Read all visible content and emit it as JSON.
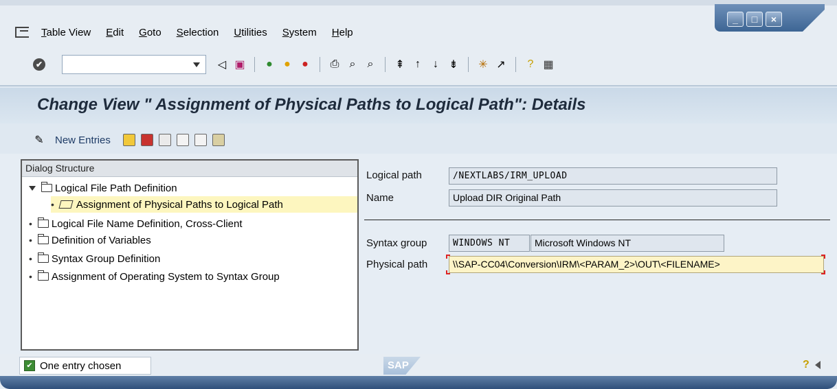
{
  "window": {
    "controls": [
      "_",
      "□",
      "×"
    ]
  },
  "menu": {
    "items": [
      "Table View",
      "Edit",
      "Goto",
      "Selection",
      "Utilities",
      "System",
      "Help"
    ]
  },
  "toolbar": {
    "command_field_value": ""
  },
  "screen": {
    "title": "Change View \" Assignment of Physical Paths to Logical Path\": Details"
  },
  "app_toolbar": {
    "new_entries_label": "New Entries"
  },
  "dialog_structure": {
    "header": "Dialog Structure",
    "items": [
      {
        "label": "Logical File Path Definition",
        "expanded": true
      },
      {
        "label": "Assignment of Physical Paths to Logical Path",
        "selected": true
      },
      {
        "label": "Logical File Name Definition, Cross-Client"
      },
      {
        "label": "Definition of Variables"
      },
      {
        "label": "Syntax Group Definition"
      },
      {
        "label": "Assignment of Operating System to Syntax Group"
      }
    ]
  },
  "details": {
    "logical_path_label": "Logical path",
    "logical_path_value": "/NEXTLABS/IRM_UPLOAD",
    "name_label": "Name",
    "name_value": "Upload DIR Original Path",
    "syntax_group_label": "Syntax group",
    "syntax_group_code": "WINDOWS NT",
    "syntax_group_text": "Microsoft Windows NT",
    "physical_path_label": "Physical path",
    "physical_path_value": "\\\\SAP-CC04\\Conversion\\IRM\\<PARAM_2>\\OUT\\<FILENAME>"
  },
  "status": {
    "message": "One entry chosen",
    "logo": "SAP"
  },
  "colors": {
    "selected_row": "#fdf6bf",
    "input_field": "#fdf4c7",
    "title_text": "#1e2b3c"
  }
}
